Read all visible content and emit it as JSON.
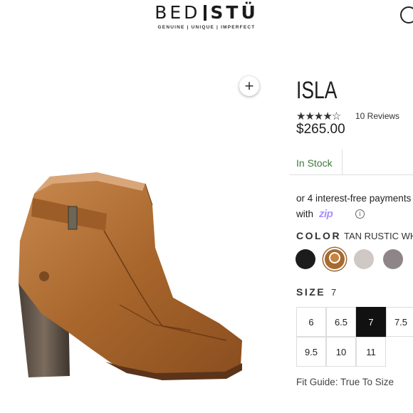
{
  "header": {
    "brand_left": "BED",
    "brand_right": "STÜ",
    "tagline": "GENUINE | UNIQUE | IMPERFECT"
  },
  "product": {
    "title": "ISLA",
    "rating": 4.5,
    "stars_display": "★★★★☆",
    "reviews": "10 Reviews",
    "price": "$265.00",
    "stock": "In Stock",
    "installments": "or 4 interest-free payments",
    "with": "with",
    "zip_logo": "zip",
    "color_label": "COLOR",
    "color_value": "TAN RUSTIC WH",
    "swatches": [
      {
        "name": "black",
        "color": "#1c1c1c"
      },
      {
        "name": "tan",
        "color": "#a86a2e",
        "selected": true
      },
      {
        "name": "grey",
        "color": "#cfc8c4"
      },
      {
        "name": "taupe",
        "color": "#8e8588"
      }
    ],
    "size_label": "SIZE",
    "size_value": "7",
    "sizes": [
      "6",
      "6.5",
      "7",
      "7.5",
      "9.5",
      "10",
      "11"
    ],
    "selected_size": "7",
    "fit_guide": "Fit Guide: True To Size"
  },
  "colors": {
    "stock_green": "#3f7a3a",
    "zip_purple": "#aa8fff"
  },
  "icons": {
    "zoom": "plus-icon",
    "header_right": "circle-icon"
  }
}
